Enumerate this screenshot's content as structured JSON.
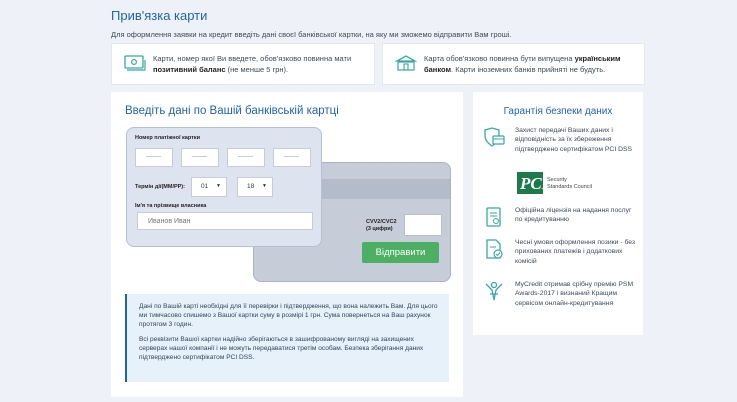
{
  "header": {
    "title": "Прив'язка карти",
    "subtitle": "Для оформлення заявки на кредит введіть дані своєї банківської картки, на яку ми зможемо відправити Вам гроші."
  },
  "info_boxes": [
    {
      "icon": "money-card-icon",
      "text_before": "Карти, номер якої Ви введете, обов'язково повинна мати ",
      "bold": "позитивний баланс",
      "text_after": " (не менше 5 грн)."
    },
    {
      "icon": "bank-icon",
      "text_before": "Карта обов'язково повинна бути випущена ",
      "bold": "українським банком",
      "text_after": ". Карти іноземних банків прийняті не будуть."
    }
  ],
  "card_form": {
    "title": "Введіть дані по Вашій банківській картці",
    "card_number_label": "Номер платіжної картки",
    "expiry_label": "Термін дії(ММ/РР):",
    "expiry_month": "01",
    "expiry_year": "18",
    "holder_label": "Ім'я та прізвище власника",
    "holder_placeholder": "Иванов Иван",
    "cvv_label_line1": "CVV2/CVC2",
    "cvv_label_line2": "(3 цифри)",
    "submit_label": "Відправити"
  },
  "note": {
    "paragraph1": "Дані по Вашій карті необхідні для її перевірки і підтвердження, що вона належить Вам. Для цього ми тимчасово спишемо з Вашої картки суму в розмірі 1 грн. Сума повернеться на Ваш рахунок протягом 3 годин.",
    "paragraph2": "Всі реквізити Вашої картки надійно зберігаються в зашифрованому вигляді на захищених серверах нашої компанії і не можуть передаватися третім особам. Безпека зберігання даних підтверджено сертифікатом PCI DSS."
  },
  "security": {
    "title": "Гарантія безпеки даних",
    "items": [
      {
        "icon": "shield-card-icon",
        "text": "Захист передачі Ваших даних і відповідність за їх збереження підтверджено сертифікатом PCI DSS"
      },
      {
        "icon": "license-document-icon",
        "text": "Офіційна ліцензія на надання послуг по кредитуванню"
      },
      {
        "icon": "document-check-icon",
        "text": "Чесні умови оформлення позики - без прихованих платежів і додаткових комісій"
      },
      {
        "icon": "award-person-icon",
        "text": "MyCredit отримав срібну премію PSM Awards-2017 і визнаний Кращим сервісом онлайн-кредитування"
      }
    ],
    "pci_logo_text": "PCI",
    "pci_logo_sub1": "Security",
    "pci_logo_sub2": "Standards Council"
  },
  "colors": {
    "accent": "#1f64a8",
    "button": "#4caf63",
    "icon": "#3aa7a0",
    "background": "#eef2f8"
  }
}
